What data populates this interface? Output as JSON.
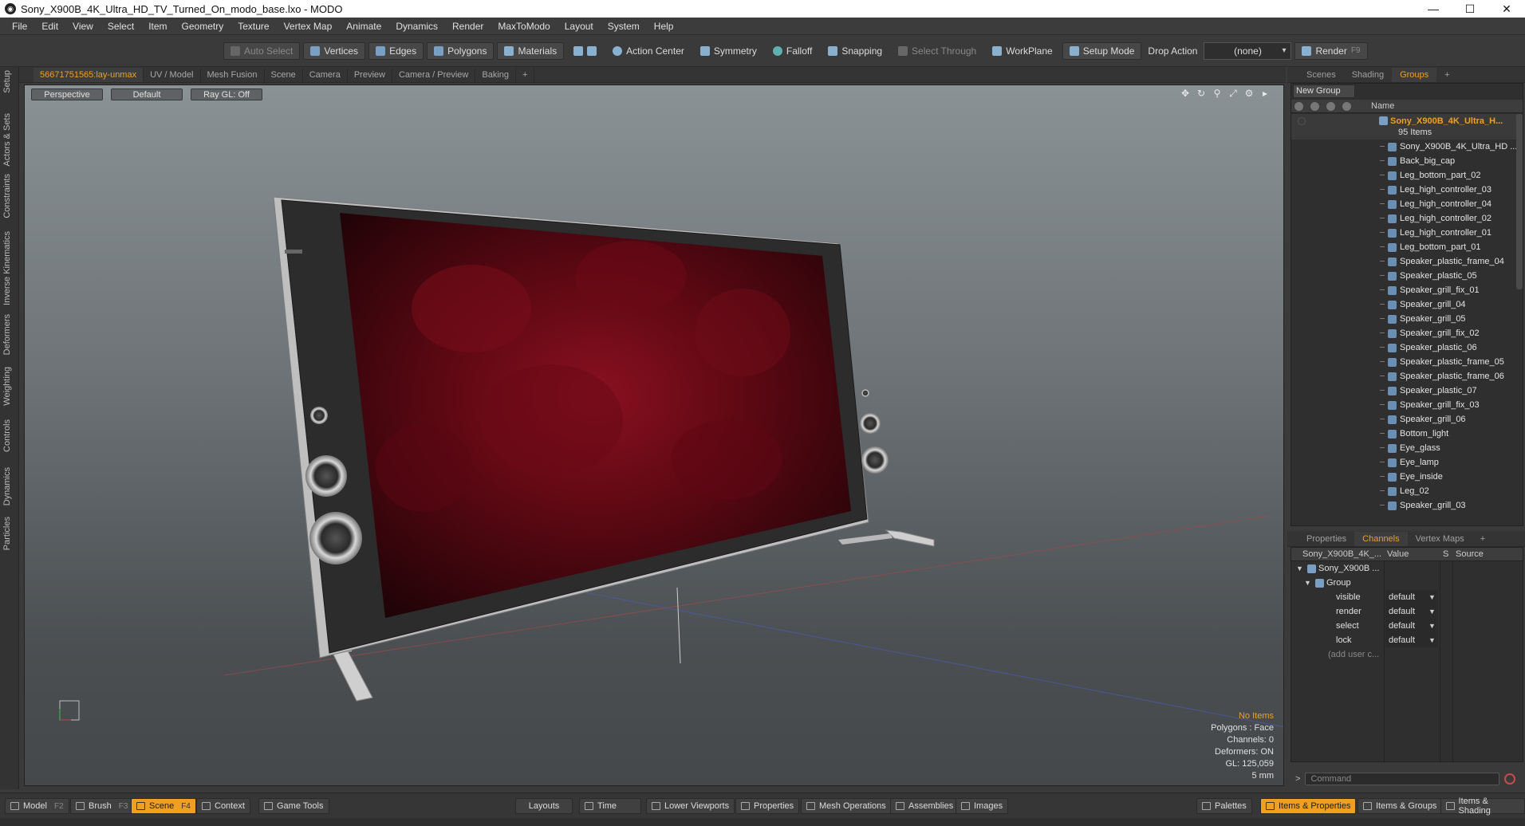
{
  "window": {
    "title": "Sony_X900B_4K_Ultra_HD_TV_Turned_On_modo_base.lxo - MODO",
    "controls": [
      "—",
      "☐",
      "✕"
    ]
  },
  "menu": [
    "File",
    "Edit",
    "View",
    "Select",
    "Item",
    "Geometry",
    "Texture",
    "Vertex Map",
    "Animate",
    "Dynamics",
    "Render",
    "MaxToModo",
    "Layout",
    "System",
    "Help"
  ],
  "toolbar": {
    "auto_select": "Auto Select",
    "vertices": "Vertices",
    "edges": "Edges",
    "polygons": "Polygons",
    "materials": "Materials",
    "action_center": "Action Center",
    "symmetry": "Symmetry",
    "falloff": "Falloff",
    "snapping": "Snapping",
    "select_through": "Select Through",
    "workplane": "WorkPlane",
    "setup_mode": "Setup Mode",
    "drop_action": "Drop Action",
    "drop_value": "(none)",
    "render": "Render",
    "render_key": "F9"
  },
  "left_tabs": [
    "Setup",
    "Actors & Sets",
    "Constraints",
    "Inverse Kinematics",
    "Deformers",
    "Weighting",
    "Controls",
    "Dynamics",
    "Particles"
  ],
  "viewport_tabs": [
    "56671751565:lay-unmax",
    "UV / Model",
    "Mesh Fusion",
    "Scene",
    "Camera",
    "Preview",
    "Camera / Preview",
    "Baking",
    "+"
  ],
  "viewport": {
    "view": "Perspective",
    "shading": "Default",
    "raygl": "Ray GL: Off",
    "info": {
      "items": "No Items",
      "polygons": "Polygons : Face",
      "channels": "Channels: 0",
      "deformers": "Deformers: ON",
      "gl": "GL: 125,059",
      "scale": "5 mm"
    }
  },
  "right_tabs_top": [
    "Scenes",
    "Shading",
    "Groups",
    "+"
  ],
  "groups": {
    "new_group": "New Group",
    "name_header": "Name",
    "root_name": "Sony_X900B_4K_Ultra_H...",
    "root_count": "95 Items",
    "items": [
      "Sony_X900B_4K_Ultra_HD ...",
      "Back_big_cap",
      "Leg_bottom_part_02",
      "Leg_high_controller_03",
      "Leg_high_controller_04",
      "Leg_high_controller_02",
      "Leg_high_controller_01",
      "Leg_bottom_part_01",
      "Speaker_plastic_frame_04",
      "Speaker_plastic_05",
      "Speaker_grill_fix_01",
      "Speaker_grill_04",
      "Speaker_grill_05",
      "Speaker_grill_fix_02",
      "Speaker_plastic_06",
      "Speaker_plastic_frame_05",
      "Speaker_plastic_frame_06",
      "Speaker_plastic_07",
      "Speaker_grill_fix_03",
      "Speaker_grill_06",
      "Bottom_light",
      "Eye_glass",
      "Eye_lamp",
      "Eye_inside",
      "Leg_02",
      "Speaker_grill_03"
    ]
  },
  "right_tabs_mid": [
    "Properties",
    "Channels",
    "Vertex Maps",
    "+"
  ],
  "channels": {
    "header_item": "Sony_X900B_4K_...",
    "header_value": "Value",
    "header_s": "S",
    "header_source": "Source",
    "root": "Sony_X900B ...",
    "group": "Group",
    "rows": [
      {
        "name": "visible",
        "value": "default"
      },
      {
        "name": "render",
        "value": "default"
      },
      {
        "name": "select",
        "value": "default"
      },
      {
        "name": "lock",
        "value": "default"
      }
    ],
    "add_user": "(add user c..."
  },
  "command": {
    "placeholder": "Command",
    "caret": ">"
  },
  "bottom": {
    "model": "Model",
    "model_key": "F2",
    "brush": "Brush",
    "brush_key": "F3",
    "scene": "Scene",
    "scene_key": "F4",
    "context": "Context",
    "game_tools": "Game Tools",
    "layouts": "Layouts",
    "time": "Time",
    "lower_viewports": "Lower Viewports",
    "properties": "Properties",
    "mesh_operations": "Mesh Operations",
    "assemblies": "Assemblies",
    "images": "Images",
    "palettes": "Palettes",
    "items_properties": "Items & Properties",
    "items_groups": "Items & Groups",
    "items_shading": "Items & Shading"
  },
  "colors": {
    "accent": "#f0a020",
    "panel": "#2f2f2f",
    "selected_group": "#f0a020"
  }
}
